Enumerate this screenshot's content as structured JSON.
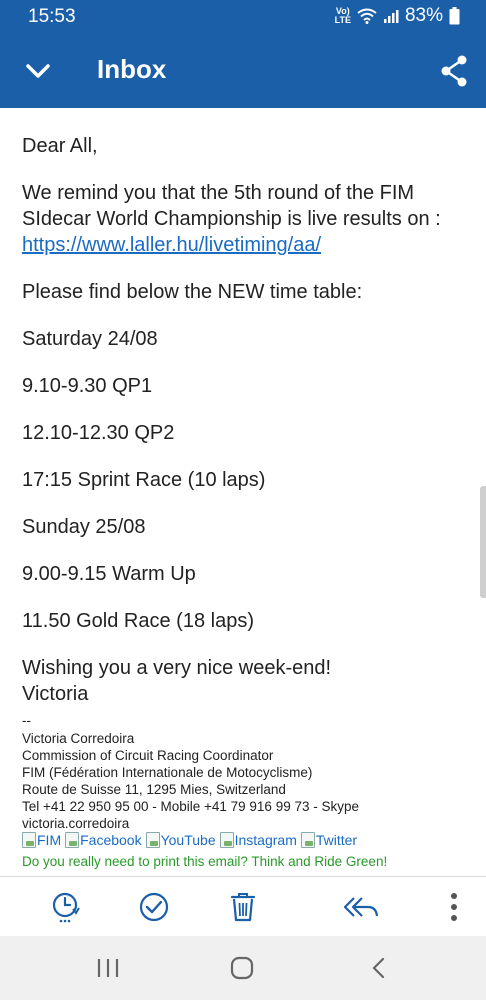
{
  "status_bar": {
    "time": "15:53",
    "volte": "VoLTE",
    "battery": "83%"
  },
  "app_bar": {
    "title": "Inbox"
  },
  "email": {
    "greeting": "Dear All,",
    "para1": "We remind you that the 5th round of the FIM SIdecar World Championship is live results on :",
    "link": "https://www.laller.hu/livetiming/aa/",
    "para2": "Please find below the NEW time table:",
    "schedule": [
      "Saturday 24/08",
      "9.10-9.30 QP1",
      "12.10-12.30 QP2",
      "17:15 Sprint Race (10 laps)",
      "Sunday 25/08",
      "9.00-9.15 Warm Up",
      "11.50 Gold Race (18 laps)"
    ],
    "closing": "Wishing you a very nice week-end!",
    "sender": "Victoria"
  },
  "signature": {
    "separator": "--",
    "name": "Victoria Corredoira",
    "role": "Commission of Circuit Racing Coordinator",
    "org": "FIM (Fédération Internationale de Motocyclisme)",
    "address": "Route de Suisse 11, 1295 Mies, Switzerland",
    "phone": "Tel +41 22 950 95 00 - Mobile +41 79 916 99 73 - Skype",
    "skype": "victoria.corredoira",
    "social": [
      "FIM",
      "Facebook",
      "YouTube",
      "Instagram",
      "Twitter"
    ],
    "green_note": "Do you really need to print this email? Think and Ride Green!"
  },
  "colors": {
    "brand": "#1b5fa8",
    "link": "#1a6bc4",
    "green": "#2a9a2a"
  }
}
